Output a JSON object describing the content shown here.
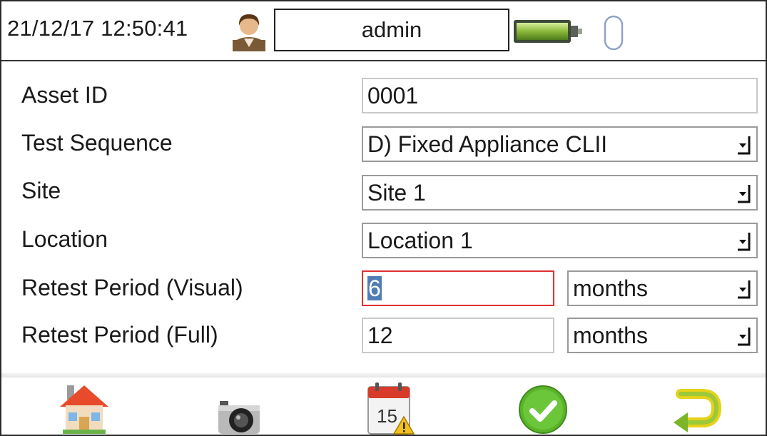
{
  "header": {
    "datetime": "21/12/17 12:50:41",
    "username": "admin",
    "icons": [
      "user-icon",
      "battery-icon",
      "usb-icon"
    ]
  },
  "form": {
    "asset_id": {
      "label": "Asset ID",
      "value": "0001"
    },
    "test_sequence": {
      "label": "Test Sequence",
      "value": "D) Fixed Appliance CLII"
    },
    "site": {
      "label": "Site",
      "value": "Site 1"
    },
    "location": {
      "label": "Location",
      "value": "Location 1"
    },
    "retest_visual": {
      "label": "Retest Period (Visual)",
      "value": "6",
      "unit": "months"
    },
    "retest_full": {
      "label": "Retest Period (Full)",
      "value": "12",
      "unit": "months"
    }
  },
  "calendar_day": "15",
  "footer": [
    "home-icon",
    "camera-icon",
    "calendar-icon",
    "confirm-icon",
    "back-icon"
  ],
  "colors": {
    "focus_border": "#e03030",
    "selection": "#4f7db5",
    "confirm_green": "#5bb32a"
  }
}
